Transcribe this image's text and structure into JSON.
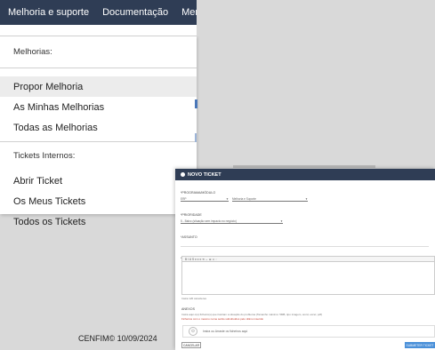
{
  "nav": {
    "items": [
      "Melhoria e suporte",
      "Documentação",
      "Menu"
    ]
  },
  "menu": {
    "section_melhorias": "Melhorias:",
    "propor": "Propor Melhoria",
    "minhas": "As Minhas Melhorias",
    "todas": "Todas as Melhorias",
    "section_tickets": "Tickets Internos:",
    "abrir": "Abrir Ticket",
    "meus": "Os Meus Tickets",
    "todos": "Todos os Tickets"
  },
  "footer": {
    "text": "CENFIM© 10/09/2024"
  },
  "ticket": {
    "title": "NOVO TICKET",
    "programa_label": "*PROGRAMA/MÓDULO",
    "programa_value": "ERP",
    "modulo_value": "Melhoria e Suporte",
    "prioridade_label": "*PRIORIDADE",
    "prioridade_value": "5 - Baixo (situação sem impacto no negócio)",
    "assunto_label": "*ASSUNTO",
    "descricao_label": "*DESCRIÇÃO",
    "toolbar": "B  I  U  S  ≡  ≡  ≡  ⟲  ⇔  ⊞  ☺  ◦",
    "chars": "Insira 120 caracteres",
    "anexos_label": "ANEXOS",
    "anexos_hint": "Insira aqui o(s) ficheiro(s) que ilustram a situação do problema (Tamanho máximo: 5MB, tipo imagem, word, excel, pdf)",
    "anexos_warn": "Ficheiros com o mesmo nome serão substituídos pelo último inserido",
    "drop_text": "Insira ou Arraste os ficheiros aqui",
    "cancel": "CANCELAR",
    "submit": "SUBMETER TICKET"
  }
}
